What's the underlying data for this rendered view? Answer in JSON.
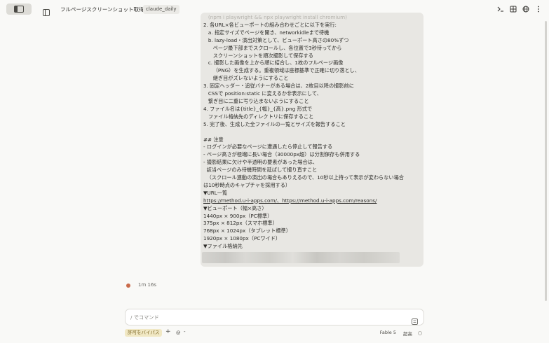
{
  "titlebar": {
    "title": "フルページスクリーンショット取得",
    "branch": "claude_daily"
  },
  "message": {
    "lines": [
      {
        "text": "   (npm i playwright && npx playwright install chromium)",
        "faded": true
      },
      {
        "text": "2. 各URL×各ビューポートの組み合わせごとに以下を実行:"
      },
      {
        "text": "   a. 指定サイズでページを開き、networkidleまで待機"
      },
      {
        "text": "   b. lazy-load・演出対策として、ビューポート高さの80%ずつ"
      },
      {
        "text": "      ページ最下部までスクロールし、各位置で3秒待ってから"
      },
      {
        "text": "      スクリーンショットを順次撮影して保存する"
      },
      {
        "text": "   c. 撮影した画像を上から順に結合し、1枚のフルページ画像"
      },
      {
        "text": "      （PNG）を生成する。重複領域は座標基準で正確に切り落とし、"
      },
      {
        "text": "      継ぎ目がズレないようにすること"
      },
      {
        "text": "3. 固定ヘッダー・追従バナーがある場合は、2枚目以降の撮影前に"
      },
      {
        "text": "   CSSで position:static に変えるか非表示にして、"
      },
      {
        "text": "   繋ぎ目に二重に写り込まないようにすること"
      },
      {
        "text": "4. ファイル名は{title}_{幅}_{高}.png 形式で"
      },
      {
        "text": "   ファイル格納先のディレクトリに保存すること"
      },
      {
        "text": "5. 完了後、生成した全ファイルの一覧とサイズを報告すること"
      },
      {
        "text": ""
      },
      {
        "text": "## 注意"
      },
      {
        "text": "- ログインが必要なページに遭遇したら停止して報告する"
      },
      {
        "text": "- ページ高さが極端に長い場合（30000px超）は分割保存も併用する"
      },
      {
        "text": "- 撮影結果に欠けや半透明の要素があった場合は、"
      },
      {
        "text": "  該当ページのみ待機時間を延ばして撮り直すこと"
      },
      {
        "text": "  （スクロール連動の演出の場合もありえるので、10秒以上待って表示が変わらない場合"
      },
      {
        "text": "は10秒時点のキャプチャを採用する）"
      },
      {
        "text": "▼URL一覧"
      },
      {
        "text": "https://method.u-i-apps.com/、https://method.u-i-apps.com/reasons/",
        "underline": true
      },
      {
        "text": "▼ビューポート（幅×高さ）"
      },
      {
        "text": "1440px × 900px（PC標準）"
      },
      {
        "text": "375px × 812px（スマホ標準）"
      },
      {
        "text": "768px × 1024px（タブレット標準）"
      },
      {
        "text": "1920px × 1080px（PCワイド）"
      },
      {
        "text": "▼ファイル格納先"
      }
    ]
  },
  "status": {
    "elapsed": "1m 16s"
  },
  "composer": {
    "placeholder": "/ でコマンド"
  },
  "bottombar": {
    "bypass_label": "許可をバイパス",
    "plus": "+",
    "at": "@",
    "minus": "-",
    "model": "Fable 5",
    "effort": "超高"
  },
  "colors": {
    "accent_dot": "#c96a4a",
    "bypass_bg": "#f1e8c4"
  }
}
